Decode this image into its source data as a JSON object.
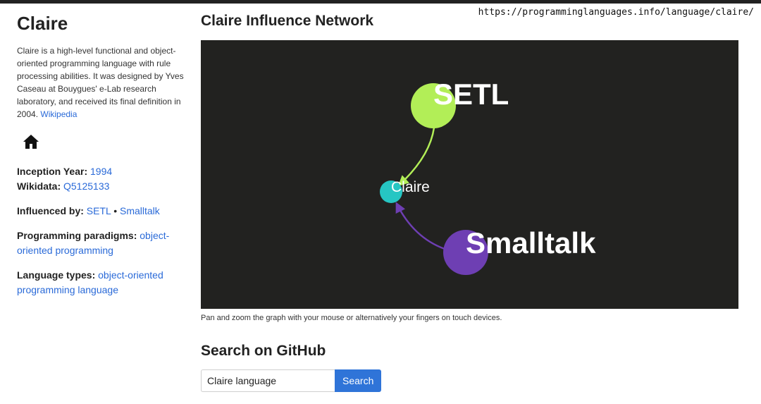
{
  "browser": {
    "url": "https://programminglanguages.info/language/claire/"
  },
  "sidebar": {
    "title": "Claire",
    "description": "Claire is a high-level functional and object-oriented programming language with rule processing abilities. It was designed by Yves Caseau at Bouygues' e-Lab research laboratory, and received its final definition in 2004.",
    "wikipedia_link": "Wikipedia",
    "inception_label": "Inception Year:",
    "inception_value": "1994",
    "wikidata_label": "Wikidata:",
    "wikidata_value": "Q5125133",
    "influenced_label": "Influenced by:",
    "influenced_items": [
      "SETL",
      "Smalltalk"
    ],
    "separator": "•",
    "paradigms_label": "Programming paradigms:",
    "paradigms_value": "object-oriented programming",
    "types_label": "Language types:",
    "types_value": "object-oriented programming language"
  },
  "network": {
    "title": "Claire Influence Network",
    "nodes": [
      {
        "label": "SETL",
        "color": "#b2ee57"
      },
      {
        "label": "Claire",
        "color": "#26c6c3"
      },
      {
        "label": "Smalltalk",
        "color": "#6e3fb3"
      }
    ],
    "caption": "Pan and zoom the graph with your mouse or alternatively your fingers on touch devices."
  },
  "github": {
    "title": "Search on GitHub",
    "input_value": "Claire language",
    "button_label": "Search"
  },
  "colors": {
    "link": "#2a6ad8",
    "graph_bg": "#222220",
    "button": "#2f74d8"
  }
}
